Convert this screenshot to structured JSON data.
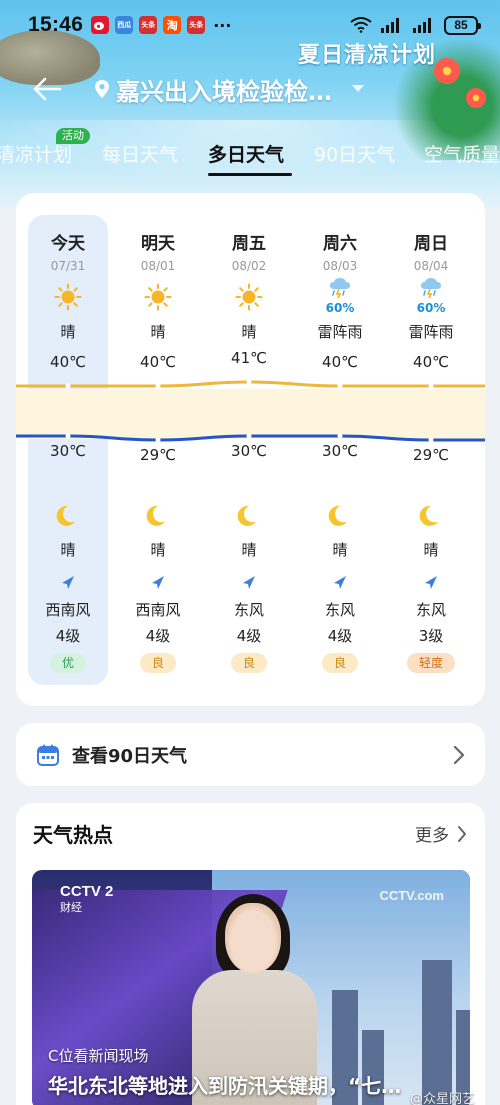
{
  "status_bar": {
    "time": "15:46",
    "apps": [
      {
        "icon": "weibo-icon",
        "color": "#e6162d",
        "label": ""
      },
      {
        "icon": "app-icon",
        "color": "#3a86d9",
        "label": "西瓜"
      },
      {
        "icon": "app-icon",
        "color": "#d62f2f",
        "label": "头条"
      },
      {
        "icon": "taobao-icon",
        "color": "#ff5000",
        "label": "淘"
      },
      {
        "icon": "app-icon",
        "color": "#d62f2f",
        "label": "头条"
      }
    ],
    "more": "···",
    "battery": "85"
  },
  "promo": {
    "text": "夏日清凉计划"
  },
  "header": {
    "location": "嘉兴出入境检验检…"
  },
  "tabs": [
    {
      "label": "清凉计划",
      "badge": "活动"
    },
    {
      "label": "每日天气"
    },
    {
      "label": "多日天气",
      "active": true
    },
    {
      "label": "90日天气"
    },
    {
      "label": "空气质量"
    }
  ],
  "forecast": {
    "days": [
      {
        "name": "今天",
        "date": "07/31",
        "icon": "sunny-icon",
        "precip": "",
        "cond": "晴",
        "hi": "40℃",
        "lo": "30℃",
        "hi_value": 40,
        "lo_value": 30,
        "night_icon": "moon-icon",
        "night_cond": "晴",
        "wind_dir": "西南风",
        "wind_lvl": "4级",
        "aqi": "优",
        "aqi_level": "excellent"
      },
      {
        "name": "明天",
        "date": "08/01",
        "icon": "sunny-icon",
        "precip": "",
        "cond": "晴",
        "hi": "40℃",
        "lo": "29℃",
        "hi_value": 40,
        "lo_value": 29,
        "night_icon": "moon-icon",
        "night_cond": "晴",
        "wind_dir": "西南风",
        "wind_lvl": "4级",
        "aqi": "良",
        "aqi_level": "good"
      },
      {
        "name": "周五",
        "date": "08/02",
        "icon": "sunny-icon",
        "precip": "",
        "cond": "晴",
        "hi": "41℃",
        "lo": "30℃",
        "hi_value": 41,
        "lo_value": 30,
        "night_icon": "moon-icon",
        "night_cond": "晴",
        "wind_dir": "东风",
        "wind_lvl": "4级",
        "aqi": "良",
        "aqi_level": "good"
      },
      {
        "name": "周六",
        "date": "08/03",
        "icon": "thunder-rain-icon",
        "precip": "60%",
        "cond": "雷阵雨",
        "hi": "40℃",
        "lo": "30℃",
        "hi_value": 40,
        "lo_value": 30,
        "night_icon": "moon-icon",
        "night_cond": "晴",
        "wind_dir": "东风",
        "wind_lvl": "4级",
        "aqi": "良",
        "aqi_level": "good"
      },
      {
        "name": "周日",
        "date": "08/04",
        "icon": "thunder-rain-icon",
        "precip": "60%",
        "cond": "雷阵雨",
        "hi": "40℃",
        "lo": "29℃",
        "hi_value": 40,
        "lo_value": 29,
        "night_icon": "moon-icon",
        "night_cond": "晴",
        "wind_dir": "东风",
        "wind_lvl": "3级",
        "aqi": "轻度",
        "aqi_level": "light"
      }
    ],
    "colors": {
      "hi_line": "#f0b63a",
      "lo_line": "#2456c8"
    }
  },
  "link90": {
    "label": "查看90日天气"
  },
  "news": {
    "title": "天气热点",
    "more": "更多",
    "video": {
      "channel": "CCTV 2",
      "channel_sub": "财经",
      "corner_logo": "CCTV.com",
      "kicker": "C位看新闻现场",
      "headline": "华北东北等地进入到防汛关键期，“七…"
    },
    "watermark": "@众星网艺"
  }
}
